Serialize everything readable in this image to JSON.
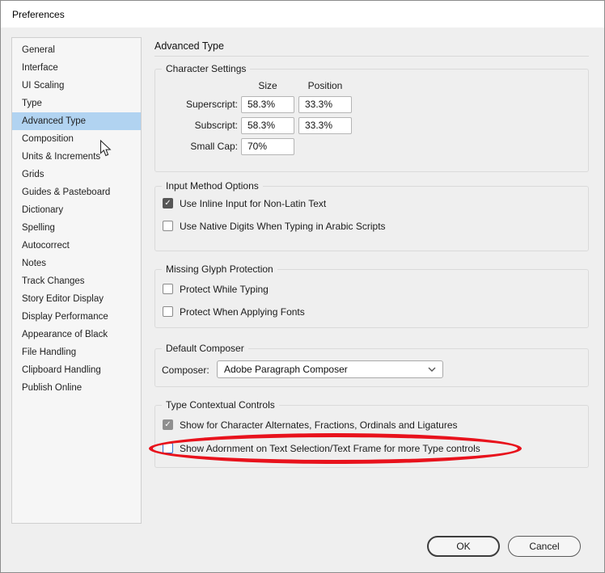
{
  "window": {
    "title": "Preferences"
  },
  "sidebar": {
    "items": [
      {
        "label": "General",
        "selected": false
      },
      {
        "label": "Interface",
        "selected": false
      },
      {
        "label": "UI Scaling",
        "selected": false
      },
      {
        "label": "Type",
        "selected": false
      },
      {
        "label": "Advanced Type",
        "selected": true
      },
      {
        "label": "Composition",
        "selected": false
      },
      {
        "label": "Units & Increments",
        "selected": false
      },
      {
        "label": "Grids",
        "selected": false
      },
      {
        "label": "Guides & Pasteboard",
        "selected": false
      },
      {
        "label": "Dictionary",
        "selected": false
      },
      {
        "label": "Spelling",
        "selected": false
      },
      {
        "label": "Autocorrect",
        "selected": false
      },
      {
        "label": "Notes",
        "selected": false
      },
      {
        "label": "Track Changes",
        "selected": false
      },
      {
        "label": "Story Editor Display",
        "selected": false
      },
      {
        "label": "Display Performance",
        "selected": false
      },
      {
        "label": "Appearance of Black",
        "selected": false
      },
      {
        "label": "File Handling",
        "selected": false
      },
      {
        "label": "Clipboard Handling",
        "selected": false
      },
      {
        "label": "Publish Online",
        "selected": false
      }
    ]
  },
  "panel": {
    "title": "Advanced Type",
    "character_settings": {
      "legend": "Character Settings",
      "col_size": "Size",
      "col_position": "Position",
      "rows": [
        {
          "label": "Superscript:",
          "size": "58.3%",
          "position": "33.3%"
        },
        {
          "label": "Subscript:",
          "size": "58.3%",
          "position": "33.3%"
        },
        {
          "label": "Small Cap:",
          "size": "70%",
          "position": null
        }
      ]
    },
    "input_method": {
      "legend": "Input Method Options",
      "options": [
        {
          "label": "Use Inline Input for Non-Latin Text",
          "checked": true
        },
        {
          "label": "Use Native Digits When Typing in Arabic Scripts",
          "checked": false
        }
      ]
    },
    "missing_glyph": {
      "legend": "Missing Glyph Protection",
      "options": [
        {
          "label": "Protect While Typing",
          "checked": false
        },
        {
          "label": "Protect When Applying Fonts",
          "checked": false
        }
      ]
    },
    "default_composer": {
      "legend": "Default Composer",
      "label": "Composer:",
      "value": "Adobe Paragraph Composer"
    },
    "type_contextual": {
      "legend": "Type Contextual Controls",
      "options": [
        {
          "label": "Show for Character Alternates, Fractions, Ordinals and Ligatures",
          "checked": true
        },
        {
          "label": "Show Adornment on Text Selection/Text Frame for more Type controls",
          "checked": false
        }
      ]
    }
  },
  "buttons": {
    "ok": "OK",
    "cancel": "Cancel"
  },
  "colors": {
    "sidebar_selection": "#b1d3f1",
    "annotation_red": "#e8121c",
    "highlight_checkbox_blue": "#2f6fd2"
  }
}
